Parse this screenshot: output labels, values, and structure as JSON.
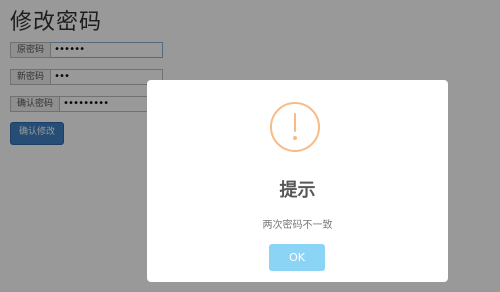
{
  "page": {
    "title": "修改密码",
    "fields": [
      {
        "label": "原密码",
        "value": "••••••"
      },
      {
        "label": "新密码",
        "value": "•••"
      },
      {
        "label": "确认密码",
        "value": "•••••••••"
      }
    ],
    "submit_label": "确认修改"
  },
  "dialog": {
    "icon": "warning-icon",
    "title": "提示",
    "message": "两次密码不一致",
    "ok_label": "OK"
  },
  "colors": {
    "accent_button": "#3f80c4",
    "warning": "#f8bb86",
    "ok_button": "#8cd4f5",
    "overlay": "rgba(0,0,0,0.4)"
  }
}
